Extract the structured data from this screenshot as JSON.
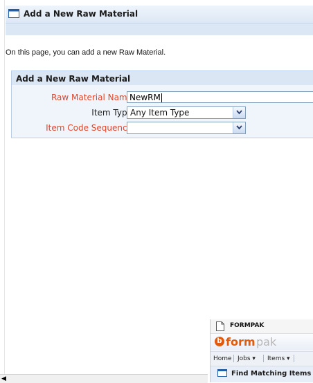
{
  "page": {
    "title": "Add a New Raw Material",
    "intro": "On this page, you can add a new Raw Material."
  },
  "form": {
    "header": "Add a New Raw Material",
    "raw_material_name": {
      "label": "Raw Material Name",
      "value": "NewRM",
      "required": true
    },
    "item_type": {
      "label": "Item Type",
      "selected": "Any Item Type",
      "required": false
    },
    "item_code_sequence": {
      "label": "Item Code Sequence",
      "selected": "",
      "required": true
    }
  },
  "popup": {
    "tab_title": "FORMPAK",
    "brand_form": "form",
    "brand_pak": "pak",
    "menu": [
      "Home",
      "Jobs ▾",
      "Items ▾"
    ],
    "panel_title": "Find Matching Items"
  },
  "colors": {
    "accent": "#1f5fa8",
    "required_label": "#e0442a",
    "brand": "#e25a0e"
  }
}
